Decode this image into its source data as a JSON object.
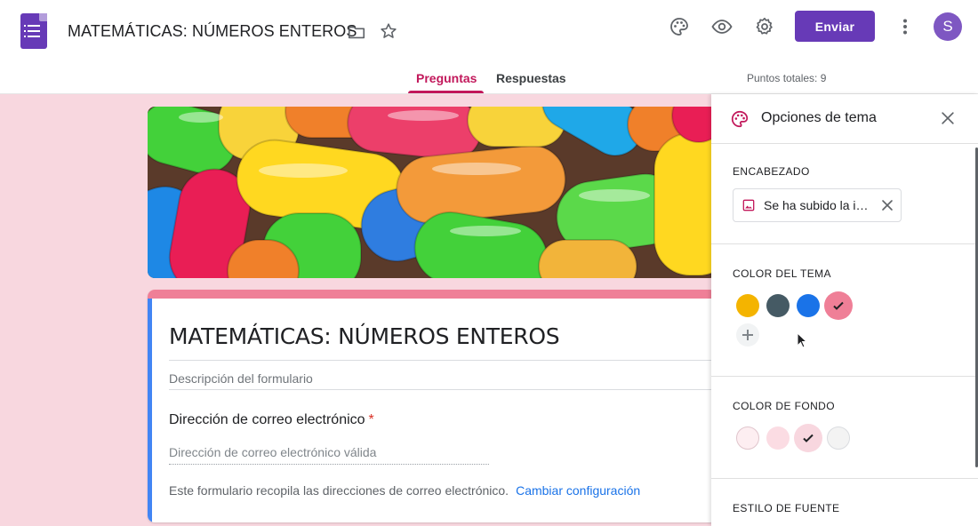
{
  "header": {
    "doc_title": "MATEMÁTICAS: NÚMEROS ENTEROS",
    "send_label": "Enviar",
    "avatar_letter": "S",
    "icons": [
      "folder-icon",
      "star-icon",
      "palette-icon",
      "eye-icon",
      "gear-icon",
      "more-vert-icon"
    ],
    "accent_color": "#673ab7"
  },
  "tabs": {
    "questions": "Preguntas",
    "responses": "Respuestas",
    "active": "Preguntas",
    "active_color": "#c2185b"
  },
  "total_points": "Puntos totales: 9",
  "form": {
    "title": "MATEMÁTICAS: NÚMEROS ENTEROS",
    "description_placeholder": "Descripción del formulario",
    "email_label": "Dirección de correo electrónico",
    "required_marker": "*",
    "email_placeholder": "Dirección de correo electrónico válida",
    "collect_note": "Este formulario recopila las direcciones de correo electrónico.",
    "change_link": "Cambiar configuración"
  },
  "theme_panel": {
    "title": "Opciones de tema",
    "header_section": "ENCABEZADO",
    "header_chip_text": "Se ha subido la i…",
    "theme_color_section": "COLOR DEL TEMA",
    "theme_colors": [
      "#f4b400",
      "#455a64",
      "#1a73e8",
      "#ef7f97"
    ],
    "theme_color_selected": "#ef7f97",
    "background_section": "COLOR DE FONDO",
    "background_colors": [
      "#fdeef1",
      "#fbdce3",
      "#f8d7df",
      "#f3f3f3"
    ],
    "background_selected": "#f8d7df",
    "font_section": "ESTILO DE FUENTE"
  }
}
